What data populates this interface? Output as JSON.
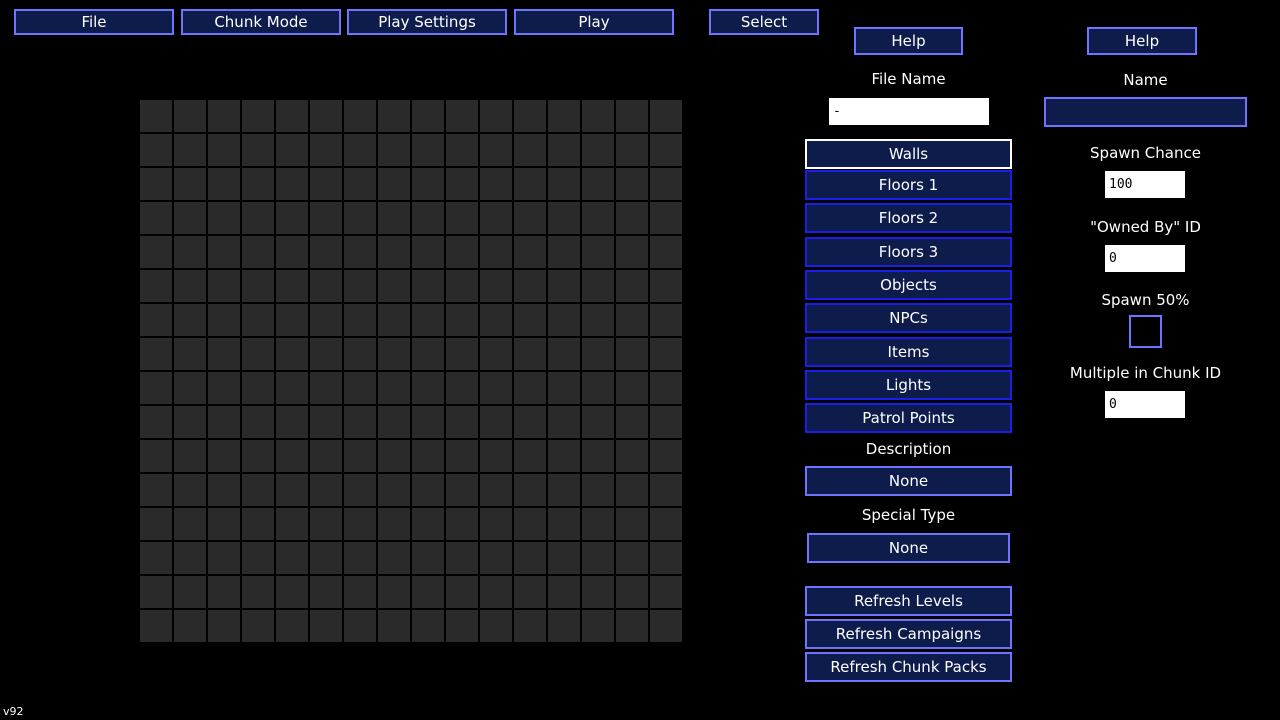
{
  "menu": {
    "file": "File",
    "chunk_mode": "Chunk Mode",
    "play_settings": "Play Settings",
    "play": "Play",
    "select": "Select"
  },
  "left_panel": {
    "help": "Help",
    "file_name_label": "File Name",
    "file_name_value": "-",
    "categories": [
      "Walls",
      "Floors 1",
      "Floors 2",
      "Floors 3",
      "Objects",
      "NPCs",
      "Items",
      "Lights",
      "Patrol Points"
    ],
    "selected_category": "Walls",
    "description_label": "Description",
    "description_value": "None",
    "special_type_label": "Special Type",
    "special_type_value": "None",
    "refresh_levels": "Refresh Levels",
    "refresh_campaigns": "Refresh Campaigns",
    "refresh_chunk_packs": "Refresh Chunk Packs"
  },
  "right_panel": {
    "help": "Help",
    "name_label": "Name",
    "name_value": "",
    "spawn_chance_label": "Spawn Chance",
    "spawn_chance_value": "100",
    "owned_by_label": "\"Owned By\" ID",
    "owned_by_value": "0",
    "spawn_50_label": "Spawn 50%",
    "spawn_50_checked": false,
    "multiple_label": "Multiple in Chunk ID",
    "multiple_value": "0"
  },
  "grid": {
    "rows": 16,
    "cols": 16
  },
  "version": "v92",
  "colors": {
    "button_fill": "#0d1c4a",
    "button_border": "#6f74ff",
    "category_border": "#1a1ee6",
    "selected_border": "#ffffff",
    "grid_cell": "#2a2a2a"
  }
}
